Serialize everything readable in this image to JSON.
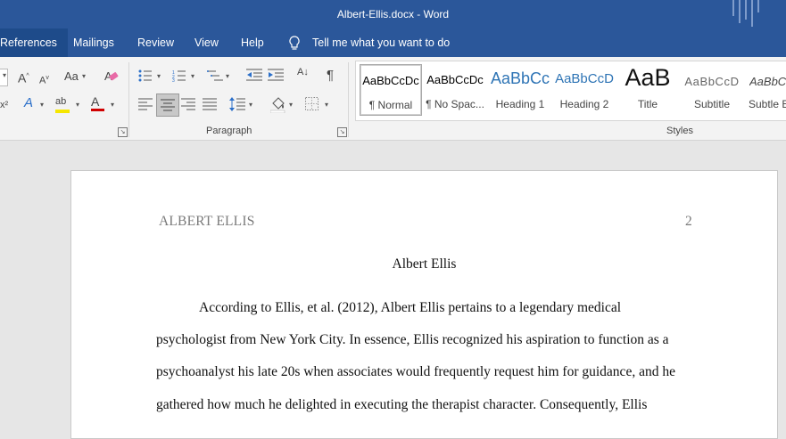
{
  "window": {
    "title": "Albert-Ellis.docx  -  Word"
  },
  "menu": {
    "tabs": [
      {
        "label": "References"
      },
      {
        "label": "Mailings"
      },
      {
        "label": "Review"
      },
      {
        "label": "View"
      },
      {
        "label": "Help"
      }
    ],
    "tell_me": "Tell me what you want to do"
  },
  "ribbon": {
    "groups": {
      "paragraph": "Paragraph",
      "styles": "Styles"
    },
    "styles": [
      {
        "preview": "AaBbCcDc",
        "name": "¶ Normal"
      },
      {
        "preview": "AaBbCcDc",
        "name": "¶ No Spac..."
      },
      {
        "preview": "AaBbCc",
        "name": "Heading 1"
      },
      {
        "preview": "AaBbCcD",
        "name": "Heading 2"
      },
      {
        "preview": "AaB",
        "name": "Title"
      },
      {
        "preview": "AaBbCcD",
        "name": "Subtitle"
      },
      {
        "preview": "AaBbCcD",
        "name": "Subtle E"
      }
    ],
    "icons": {
      "grow_font": "A",
      "shrink_font": "A",
      "change_case": "Aa",
      "text_effects": "A",
      "highlight": "ab",
      "font_color": "A",
      "show_marks": "¶",
      "sort": "A↓",
      "x2": "x²"
    },
    "colors": {
      "highlight": "#f5e600",
      "font_color": "#d00000",
      "accent": "#2b579a"
    }
  },
  "document": {
    "running_head": "ALBERT ELLIS",
    "page_number": "2",
    "heading": "Albert Ellis",
    "lines": [
      "According to Ellis, et al. (2012), Albert Ellis pertains to a legendary medical",
      "psychologist from New York City. In essence, Ellis recognized his aspiration to function as a",
      "psychoanalyst his late 20s when associates would frequently request him for guidance, and he",
      "gathered how much he delighted in executing the therapist character. Consequently, Ellis"
    ]
  }
}
